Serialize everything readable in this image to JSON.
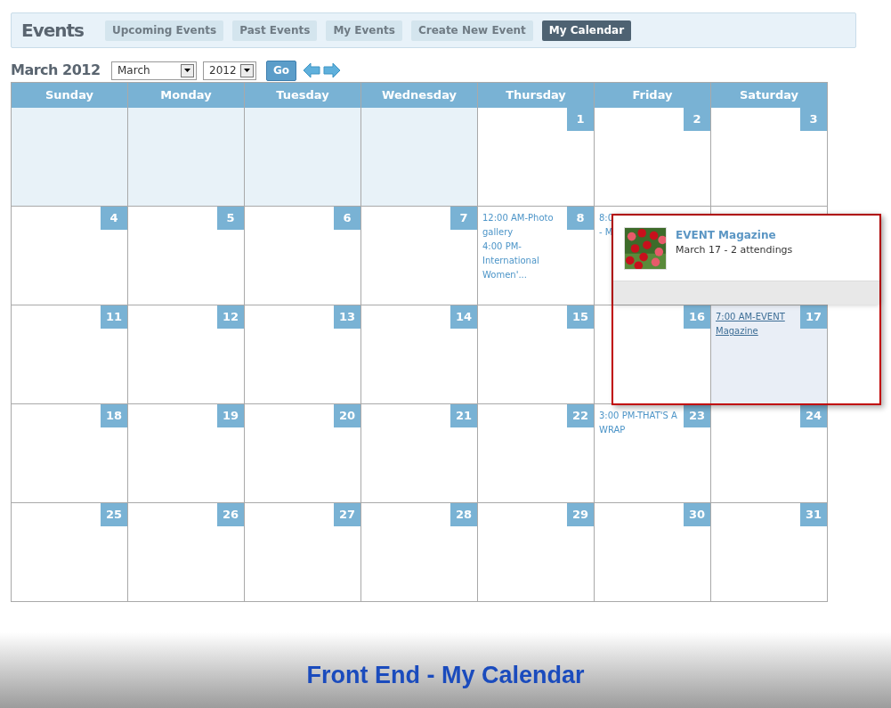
{
  "header": {
    "title": "Events",
    "tabs": [
      {
        "label": "Upcoming Events",
        "selected": false
      },
      {
        "label": "Past Events",
        "selected": false
      },
      {
        "label": "My Events",
        "selected": false
      },
      {
        "label": "Create New Event",
        "selected": false
      },
      {
        "label": "My Calendar",
        "selected": true
      }
    ]
  },
  "toolbar": {
    "heading": "March 2012",
    "month_select": {
      "value": "March"
    },
    "year_select": {
      "value": "2012"
    },
    "go_button": "Go"
  },
  "calendar": {
    "weekdays": [
      "Sunday",
      "Monday",
      "Tuesday",
      "Wednesday",
      "Thursday",
      "Friday",
      "Saturday"
    ],
    "weeks": [
      [
        {
          "kind": "blank"
        },
        {
          "kind": "blank"
        },
        {
          "kind": "blank"
        },
        {
          "kind": "blank"
        },
        {
          "kind": "day",
          "number": "1"
        },
        {
          "kind": "day",
          "number": "2"
        },
        {
          "kind": "day",
          "number": "3"
        }
      ],
      [
        {
          "kind": "day",
          "number": "4"
        },
        {
          "kind": "day",
          "number": "5"
        },
        {
          "kind": "day",
          "number": "6"
        },
        {
          "kind": "day",
          "number": "7"
        },
        {
          "kind": "day",
          "number": "8",
          "events": [
            {
              "text": "12:00 AM-Photo gallery",
              "underlined": false
            },
            {
              "text": "4:00 PM-International Women'...",
              "underlined": false
            }
          ]
        },
        {
          "kind": "day",
          "events": [
            {
              "text": "8:0",
              "underlined": false
            },
            {
              "text": "- M",
              "underlined": false
            }
          ]
        },
        {
          "kind": "day"
        }
      ],
      [
        {
          "kind": "day",
          "number": "11"
        },
        {
          "kind": "day",
          "number": "12"
        },
        {
          "kind": "day",
          "number": "13"
        },
        {
          "kind": "day",
          "number": "14"
        },
        {
          "kind": "day",
          "number": "15"
        },
        {
          "kind": "day",
          "number": "16"
        },
        {
          "kind": "highlight",
          "number": "17",
          "events": [
            {
              "text": "7:00 AM-EVENT Magazine",
              "underlined": true
            }
          ]
        }
      ],
      [
        {
          "kind": "day",
          "number": "18"
        },
        {
          "kind": "day",
          "number": "19"
        },
        {
          "kind": "day",
          "number": "20"
        },
        {
          "kind": "day",
          "number": "21"
        },
        {
          "kind": "day",
          "number": "22"
        },
        {
          "kind": "day",
          "number": "23",
          "events": [
            {
              "text": "3:00 PM-THAT'S A WRAP",
              "underlined": false
            }
          ]
        },
        {
          "kind": "day",
          "number": "24"
        }
      ],
      [
        {
          "kind": "day",
          "number": "25"
        },
        {
          "kind": "day",
          "number": "26"
        },
        {
          "kind": "day",
          "number": "27"
        },
        {
          "kind": "day",
          "number": "28"
        },
        {
          "kind": "day",
          "number": "29"
        },
        {
          "kind": "day",
          "number": "30"
        },
        {
          "kind": "day",
          "number": "31"
        }
      ]
    ]
  },
  "popup": {
    "title": "EVENT Magazine",
    "subtitle": "March 17 - 2 attendings"
  },
  "footer": {
    "caption": "Front End - My Calendar"
  }
}
